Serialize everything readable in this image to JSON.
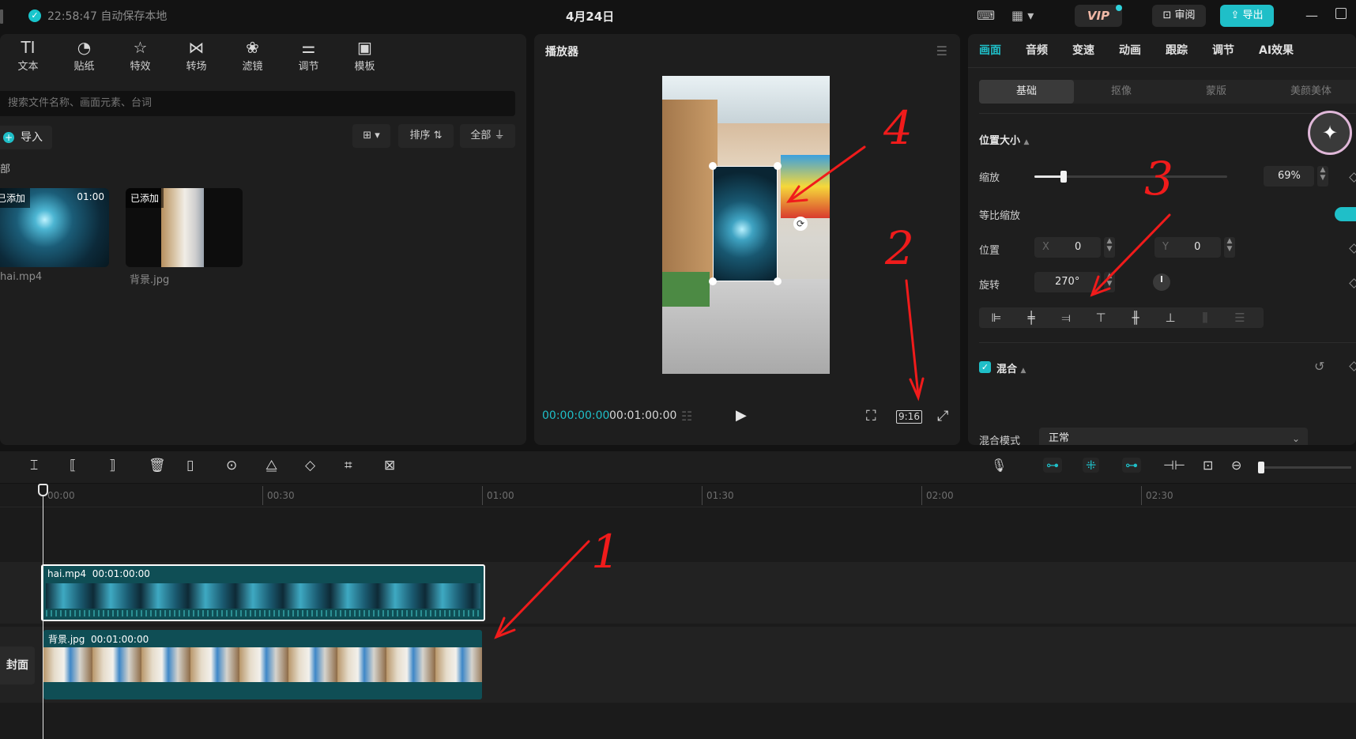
{
  "titlebar": {
    "saved_status": "22:58:47 自动保存本地",
    "project_title": "4月24日",
    "vip_label": "VIP",
    "review_label": "审阅",
    "export_label": "导出"
  },
  "media": {
    "tools": [
      {
        "icon": "text-icon",
        "glyph": "TI",
        "label": "文本"
      },
      {
        "icon": "sticker-icon",
        "glyph": "◔",
        "label": "贴纸"
      },
      {
        "icon": "effects-icon",
        "glyph": "☆",
        "label": "特效"
      },
      {
        "icon": "transition-icon",
        "glyph": "⋈",
        "label": "转场"
      },
      {
        "icon": "filter-icon",
        "glyph": "❀",
        "label": "滤镜"
      },
      {
        "icon": "adjust-icon",
        "glyph": "⚌",
        "label": "调节"
      },
      {
        "icon": "template-icon",
        "glyph": "▣",
        "label": "模板"
      }
    ],
    "search_placeholder": "搜索文件名称、画面元素、台词",
    "import_label": "导入",
    "sort_label": "排序",
    "all_label": "全部",
    "section_label": "部",
    "items": [
      {
        "badge": "已添加",
        "duration": "01:00",
        "name": "hai.mp4"
      },
      {
        "badge": "已添加",
        "duration": "",
        "name": "背景.jpg"
      }
    ]
  },
  "player": {
    "title": "播放器",
    "current_time": "00:00:00:00",
    "total_time": "00:01:00:00",
    "ratio": "9:16"
  },
  "props": {
    "tabs": [
      "画面",
      "音频",
      "变速",
      "动画",
      "跟踪",
      "调节",
      "AI效果"
    ],
    "active_tab": 0,
    "subtabs": [
      "基础",
      "抠像",
      "蒙版",
      "美颜美体"
    ],
    "active_subtab": 0,
    "position_size_label": "位置大小",
    "scale_label": "缩放",
    "scale_value": "69%",
    "scale_fraction": 0.15,
    "uniform_scale_label": "等比缩放",
    "uniform_scale_on": true,
    "position_label": "位置",
    "x_label": "X",
    "x_value": "0",
    "y_label": "Y",
    "y_value": "0",
    "rotation_label": "旋转",
    "rotation_value": "270°",
    "blend_label": "混合",
    "blend_mode_label": "混合模式",
    "blend_mode_value": "正常"
  },
  "timeline": {
    "ruler_labels": [
      "00:00",
      "00:30",
      "01:00",
      "01:30",
      "02:00",
      "02:30"
    ],
    "clips": [
      {
        "name": "hai.mp4",
        "duration": "00:01:00:00"
      },
      {
        "name": "背景.jpg",
        "duration": "00:01:00:00"
      }
    ],
    "cover_label": "封面"
  },
  "annotations": [
    "1",
    "2",
    "3",
    "4"
  ],
  "colors": {
    "accent": "#1fbfc8",
    "annotation": "#f01b1b",
    "clip": "#0f4e55"
  }
}
